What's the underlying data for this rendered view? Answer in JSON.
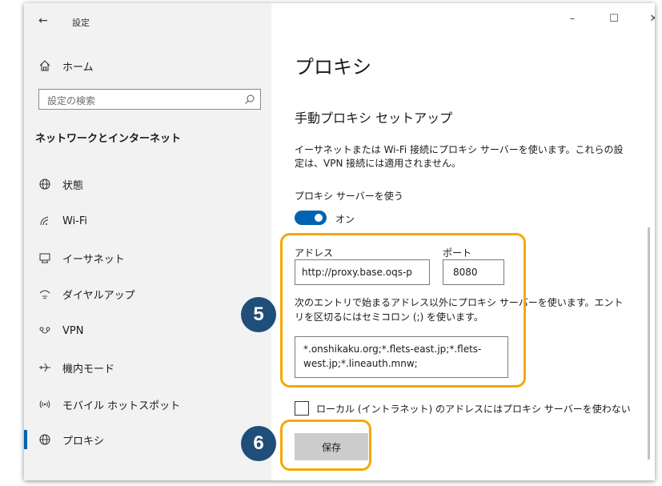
{
  "window": {
    "title": "設定",
    "controls": {
      "minimize": "–",
      "maximize": "☐",
      "close": "✕"
    }
  },
  "sidebar": {
    "home": {
      "label": "ホーム",
      "icon": "home-icon"
    },
    "search": {
      "placeholder": "設定の検索",
      "icon": "search-icon"
    },
    "section_title": "ネットワークとインターネット",
    "items": [
      {
        "label": "状態",
        "icon": "globe-icon"
      },
      {
        "label": "Wi-Fi",
        "icon": "wifi-icon"
      },
      {
        "label": "イーサネット",
        "icon": "ethernet-icon"
      },
      {
        "label": "ダイヤルアップ",
        "icon": "dialup-icon"
      },
      {
        "label": "VPN",
        "icon": "vpn-icon"
      },
      {
        "label": "機内モード",
        "icon": "airplane-icon"
      },
      {
        "label": "モバイル ホットスポット",
        "icon": "hotspot-icon"
      },
      {
        "label": "プロキシ",
        "icon": "globe-icon",
        "active": true
      }
    ]
  },
  "main": {
    "title": "プロキシ",
    "section_title": "手動プロキシ セットアップ",
    "description": "イーサネットまたは Wi-Fi 接続にプロキシ サーバーを使います。これらの設定は、VPN 接続には適用されません。",
    "toggle": {
      "label": "プロキシ サーバーを使う",
      "state": "オン",
      "on": true
    },
    "address": {
      "label": "アドレス",
      "value": "http://proxy.base.oqs-p"
    },
    "port": {
      "label": "ポート",
      "value": "8080"
    },
    "exceptions": {
      "description": "次のエントリで始まるアドレス以外にプロキシ サーバーを使います。エントリを区切るにはセミコロン (;) を使います。",
      "value": "*.onshikaku.org;*.flets-east.jp;*.flets-west.jp;*.lineauth.mnw;"
    },
    "local_bypass": {
      "label": "ローカル (イントラネット) のアドレスにはプロキシ サーバーを使わない",
      "checked": false
    },
    "save_label": "保存"
  },
  "annotations": {
    "step5": "5",
    "step6": "6",
    "color": "#f5a800",
    "badge_color": "#1f4e79"
  },
  "colors": {
    "accent": "#0063b1",
    "sidebar_bg": "#f2f2f2"
  }
}
